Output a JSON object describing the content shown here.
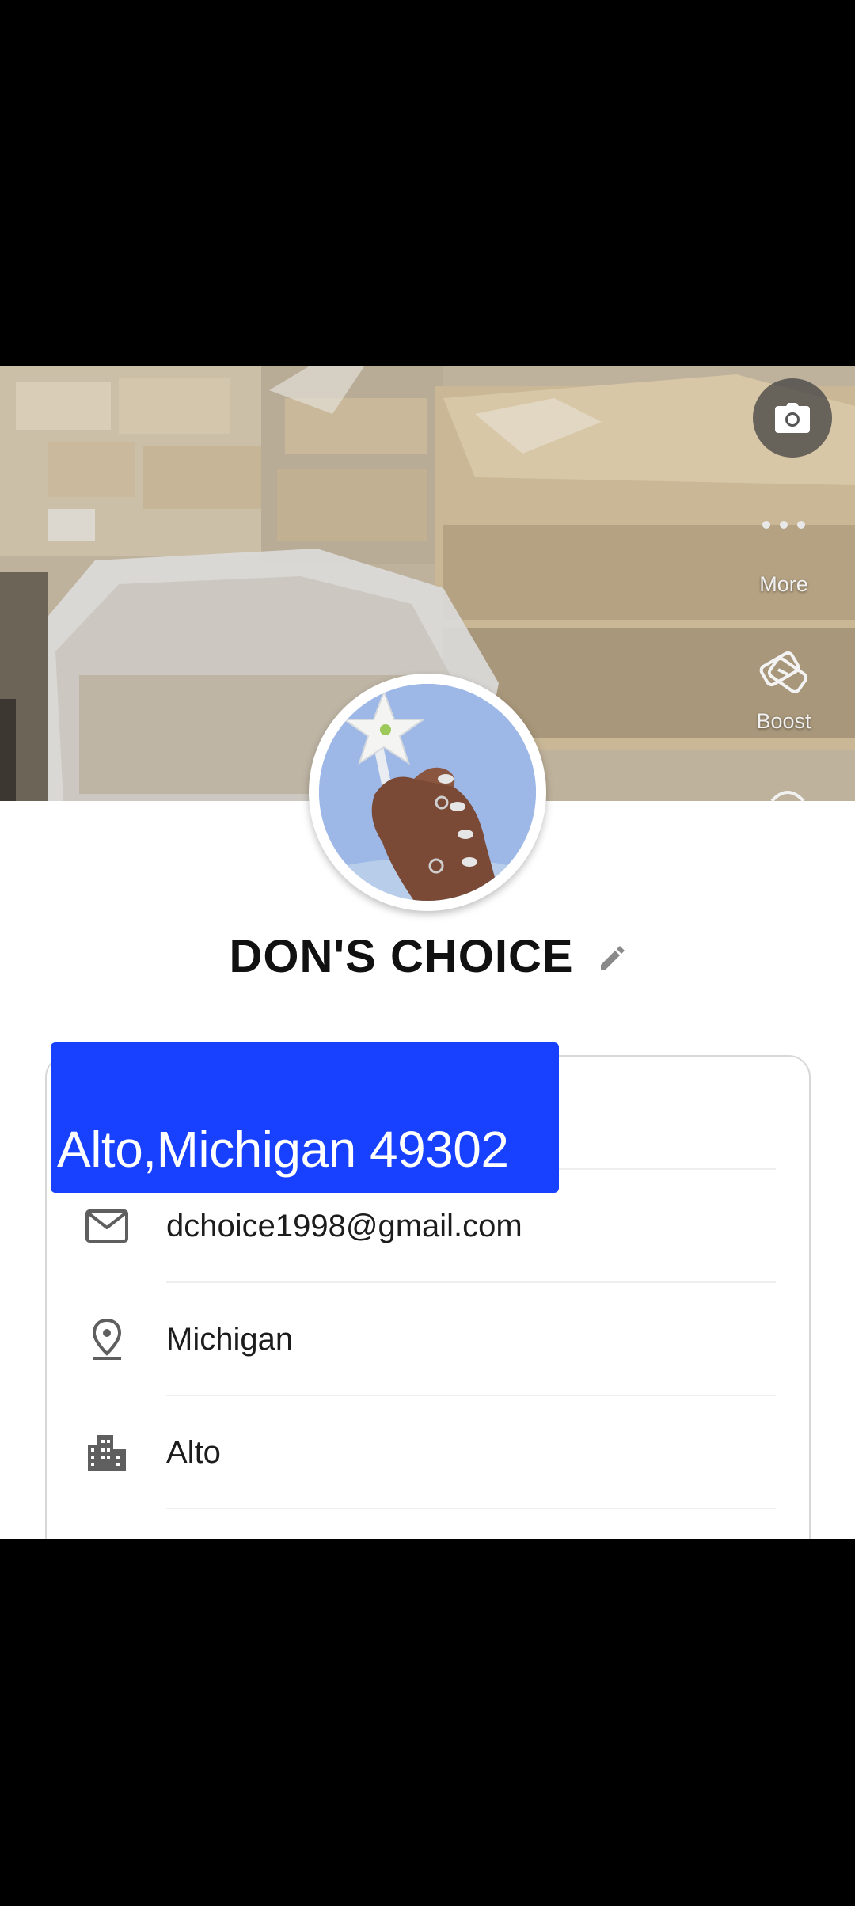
{
  "cover": {
    "camera_icon": "camera-icon",
    "more_label": "More",
    "more_icon": "more-horizontal-icon",
    "boost_label": "Boost",
    "boost_icon": "boost-icon"
  },
  "profile": {
    "name": "DON'S CHOICE",
    "edit_icon": "pencil-icon",
    "highlighted_address": "Alto,Michigan 49302"
  },
  "info": {
    "email": "dchoice1998@gmail.com",
    "state": "Michigan",
    "city": "Alto"
  },
  "icons": {
    "email": "mail-icon",
    "state": "location-pin-icon",
    "city": "city-buildings-icon"
  },
  "colors": {
    "highlight": "#1740ff",
    "icon_gray": "#5f5f5f"
  }
}
